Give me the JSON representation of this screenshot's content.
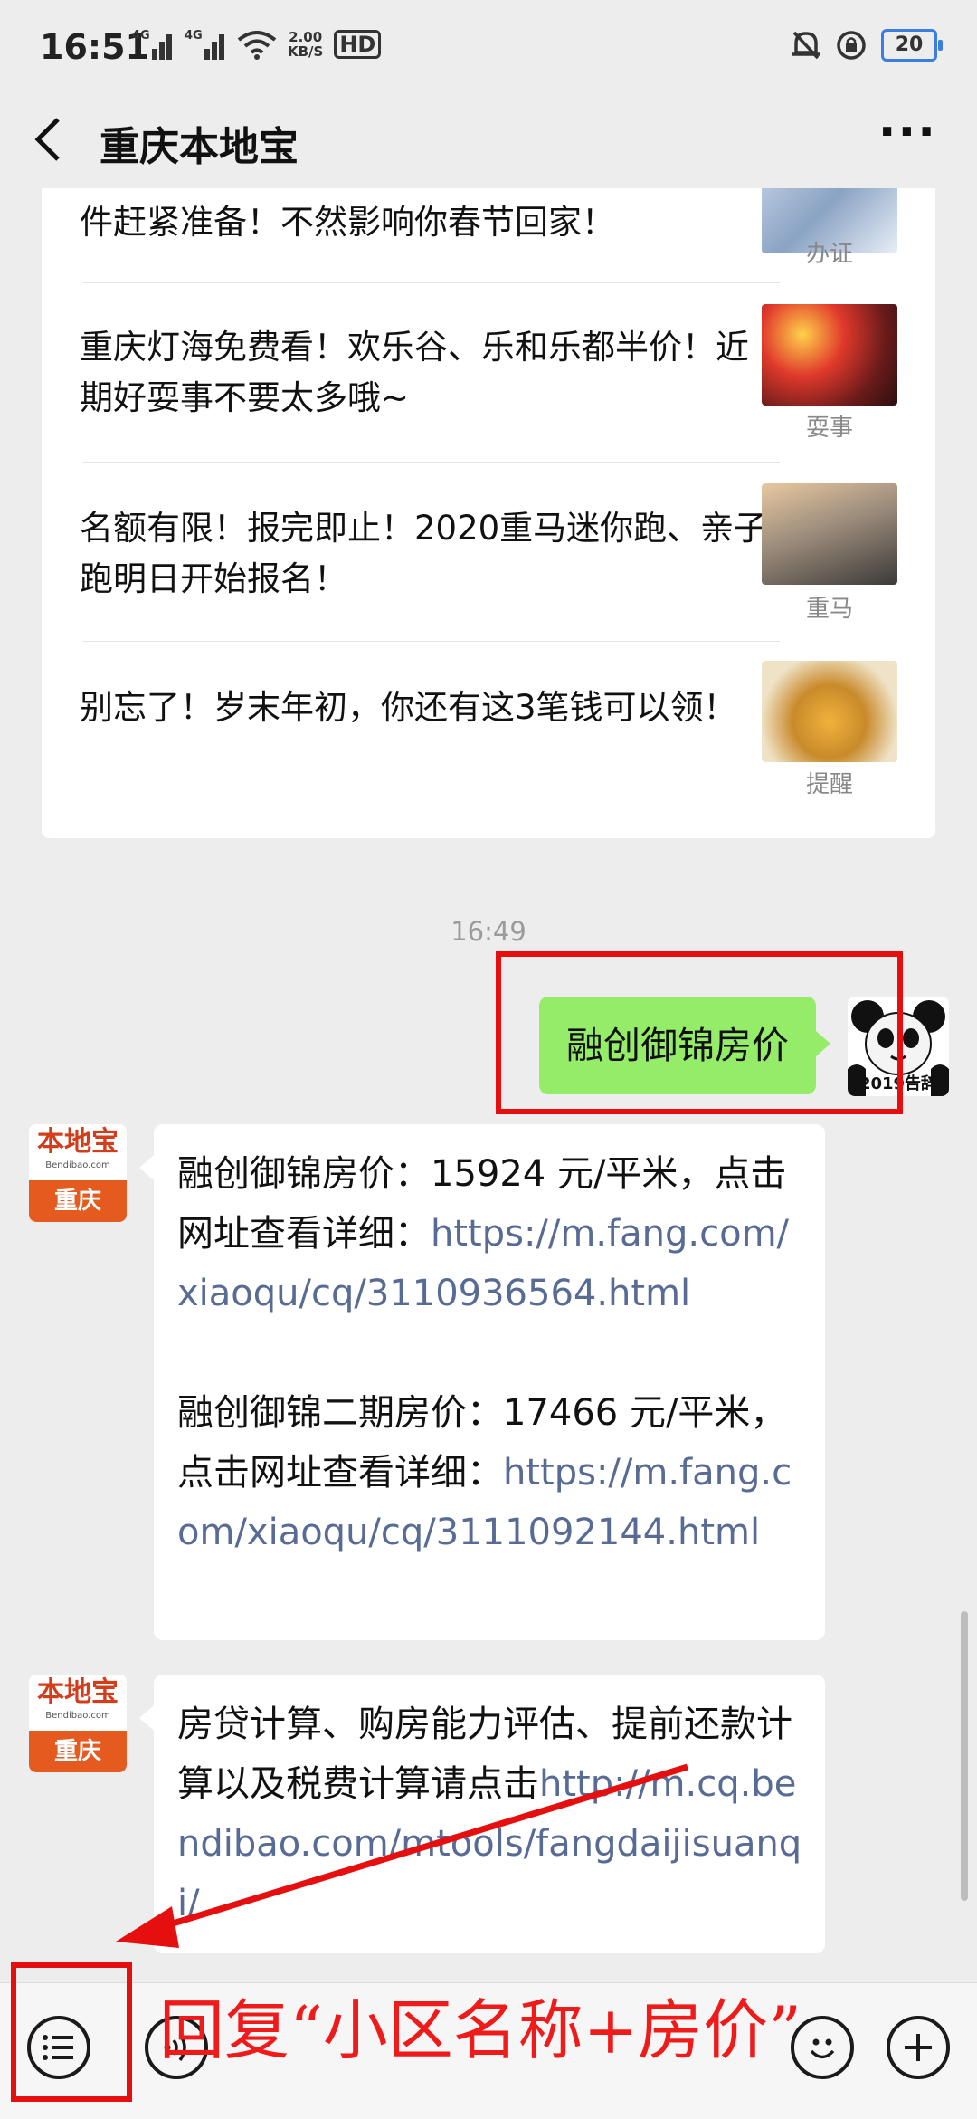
{
  "status_bar": {
    "time": "16:51",
    "network_1": "4G",
    "network_2": "4G",
    "speed_value": "2.00",
    "speed_unit": "KB/S",
    "hd_label": "HD",
    "battery": "20"
  },
  "nav": {
    "title": "重庆本地宝",
    "more": "···"
  },
  "articles": [
    {
      "title": "件赶紧准备！不然影响你春节回家！",
      "tag": "办证"
    },
    {
      "title": "重庆灯海免费看！欢乐谷、乐和乐都半价！近期好耍事不要太多哦~",
      "tag": "耍事"
    },
    {
      "title": "名额有限！报完即止！2020重马迷你跑、亲子跑明日开始报名！",
      "tag": "重马"
    },
    {
      "title": "别忘了！岁末年初，你还有这3笔钱可以领！",
      "tag": "提醒"
    }
  ],
  "timestamp": "16:49",
  "user_message": {
    "text": "融创御锦房价",
    "avatar_caption": "2019告辞"
  },
  "bot": {
    "avatar_logo": "本地宝",
    "avatar_site": "Bendibao.com",
    "avatar_city": "重庆",
    "reply1": {
      "p1_text": "融创御锦房价：15924 元/平米，点击网址查看详细：",
      "p1_link": "https://m.fang.com/xiaoqu/cq/3110936564.html",
      "p2_text": "融创御锦二期房价：17466 元/平米，点击网址查看详细：",
      "p2_link": "https://m.fang.com/xiaoqu/cq/3111092144.html"
    },
    "reply2": {
      "text": "房贷计算、购房能力评估、提前还款计算以及税费计算请点击",
      "link": "http://m.cq.bendibao.com/mtools/fangdaijisuanqi/"
    }
  },
  "annotation": {
    "text": "回复“小区名称+房价”",
    "color": "#e60f0f"
  },
  "bottom_bar": {
    "menu_icon": "list-menu-icon",
    "voice_icon": "voice-icon",
    "emoji_icon": "emoji-icon",
    "plus_icon": "plus-icon"
  }
}
